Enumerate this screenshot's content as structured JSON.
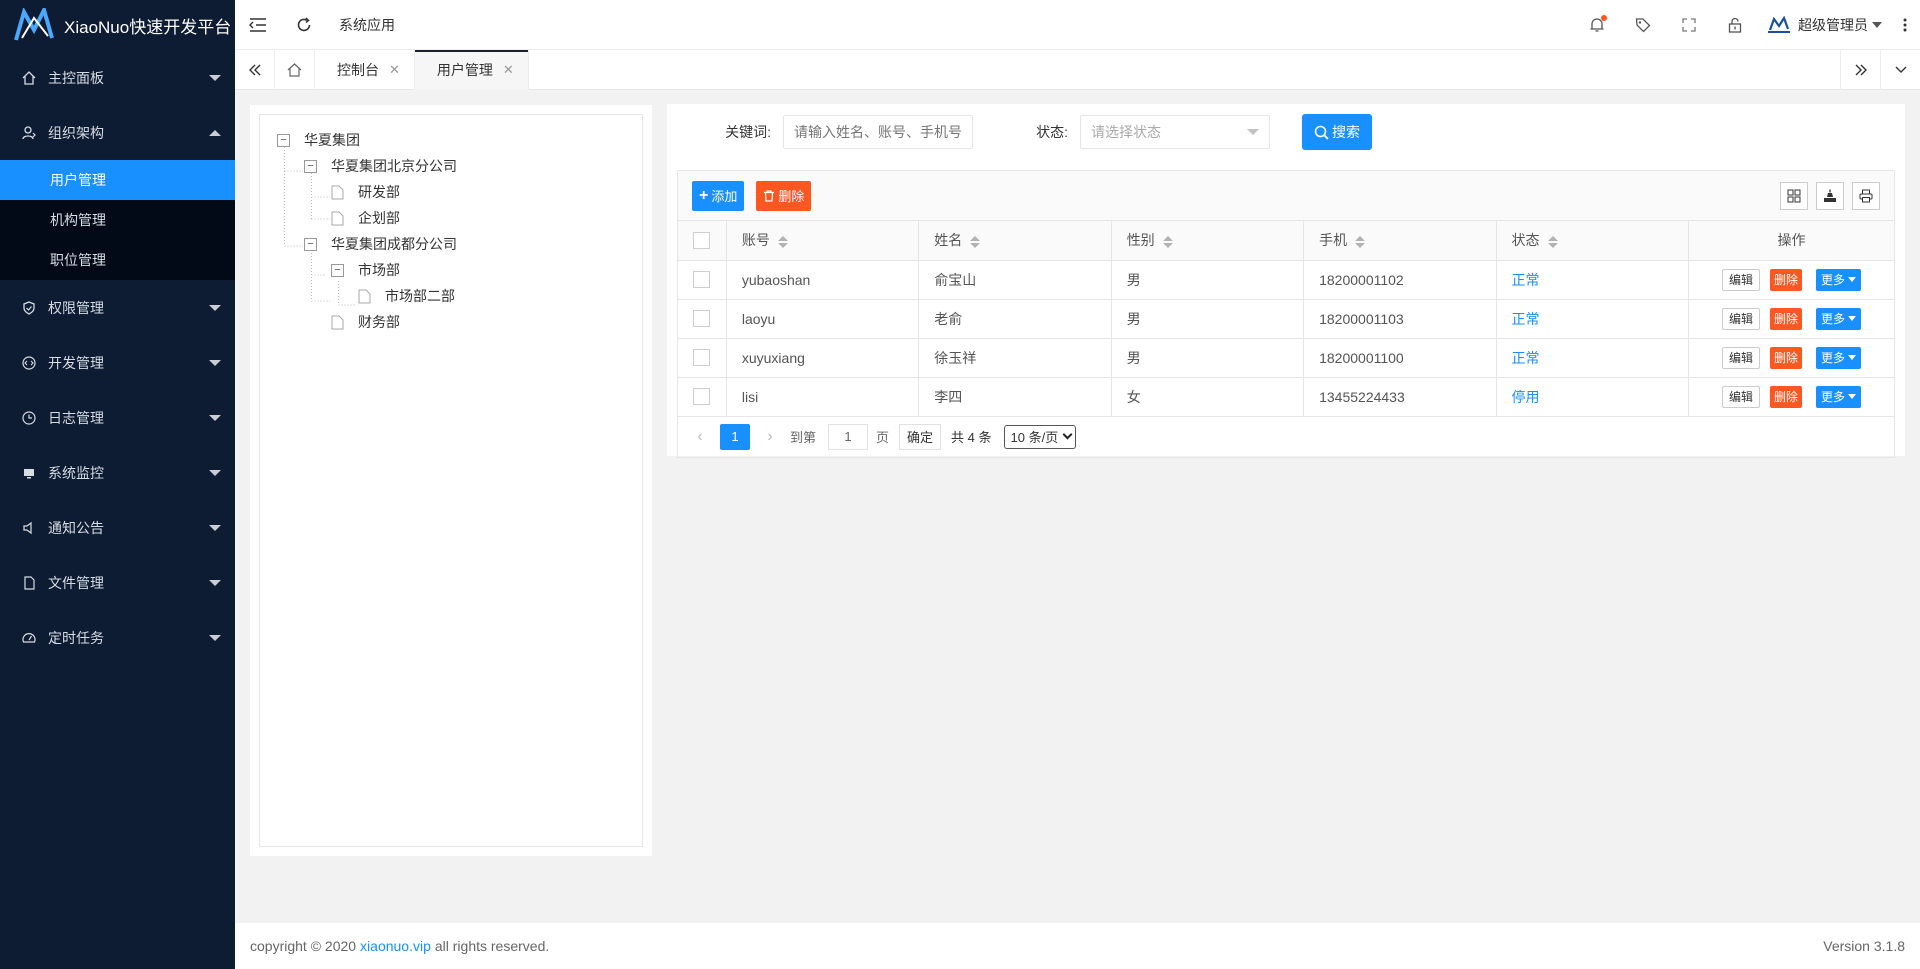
{
  "brand": {
    "title": "XiaoNuo快速开发平台",
    "accent": "#1890ff"
  },
  "sidebar": {
    "items": [
      {
        "label": "主控面板",
        "icon": "home-icon",
        "expanded": false
      },
      {
        "label": "组织架构",
        "icon": "user-group-icon",
        "expanded": true,
        "children": [
          {
            "label": "用户管理",
            "active": true
          },
          {
            "label": "机构管理",
            "active": false
          },
          {
            "label": "职位管理",
            "active": false
          }
        ]
      },
      {
        "label": "权限管理",
        "icon": "shield-icon",
        "expanded": false
      },
      {
        "label": "开发管理",
        "icon": "code-icon",
        "expanded": false
      },
      {
        "label": "日志管理",
        "icon": "clock-icon",
        "expanded": false
      },
      {
        "label": "系统监控",
        "icon": "monitor-icon",
        "expanded": false
      },
      {
        "label": "通知公告",
        "icon": "speaker-icon",
        "expanded": false
      },
      {
        "label": "文件管理",
        "icon": "file-icon",
        "expanded": false
      },
      {
        "label": "定时任务",
        "icon": "dashboard-icon",
        "expanded": false
      }
    ]
  },
  "header": {
    "app_name": "系统应用",
    "user_name": "超级管理员",
    "notification_dot": "#ff5722"
  },
  "tabs": {
    "items": [
      {
        "label": "控制台",
        "active": false
      },
      {
        "label": "用户管理",
        "active": true
      }
    ]
  },
  "tree": {
    "nodes": [
      {
        "label": "华夏集团",
        "level": 0,
        "type": "folder"
      },
      {
        "label": "华夏集团北京分公司",
        "level": 1,
        "type": "folder"
      },
      {
        "label": "研发部",
        "level": 2,
        "type": "leaf"
      },
      {
        "label": "企划部",
        "level": 2,
        "type": "leaf"
      },
      {
        "label": "华夏集团成都分公司",
        "level": 1,
        "type": "folder"
      },
      {
        "label": "市场部",
        "level": 2,
        "type": "folder"
      },
      {
        "label": "市场部二部",
        "level": 3,
        "type": "leaf"
      },
      {
        "label": "财务部",
        "level": 2,
        "type": "leaf"
      }
    ]
  },
  "search": {
    "keyword_label": "关键词:",
    "keyword_placeholder": "请输入姓名、账号、手机号",
    "status_label": "状态:",
    "status_placeholder": "请选择状态",
    "search_button": "搜索"
  },
  "toolbar": {
    "add_label": "添加",
    "delete_label": "删除"
  },
  "table": {
    "columns": [
      "账号",
      "姓名",
      "性别",
      "手机",
      "状态",
      "操作"
    ],
    "rows": [
      {
        "account": "yubaoshan",
        "name": "俞宝山",
        "gender": "男",
        "phone": "18200001102",
        "status": "正常"
      },
      {
        "account": "laoyu",
        "name": "老俞",
        "gender": "男",
        "phone": "18200001103",
        "status": "正常"
      },
      {
        "account": "xuyuxiang",
        "name": "徐玉祥",
        "gender": "男",
        "phone": "18200001100",
        "status": "正常"
      },
      {
        "account": "lisi",
        "name": "李四",
        "gender": "女",
        "phone": "13455224433",
        "status": "停用"
      }
    ],
    "row_actions": {
      "edit": "编辑",
      "delete": "删除",
      "more": "更多"
    }
  },
  "pager": {
    "current_page": "1",
    "goto_label": "到第",
    "goto_value": "1",
    "page_unit": "页",
    "confirm": "确定",
    "total": "共 4 条",
    "page_size": "10 条/页"
  },
  "footer": {
    "copyright_prefix": "copyright © 2020",
    "link": "xiaonuo.vip",
    "copyright_suffix": "all rights reserved.",
    "version": "Version 3.1.8"
  }
}
